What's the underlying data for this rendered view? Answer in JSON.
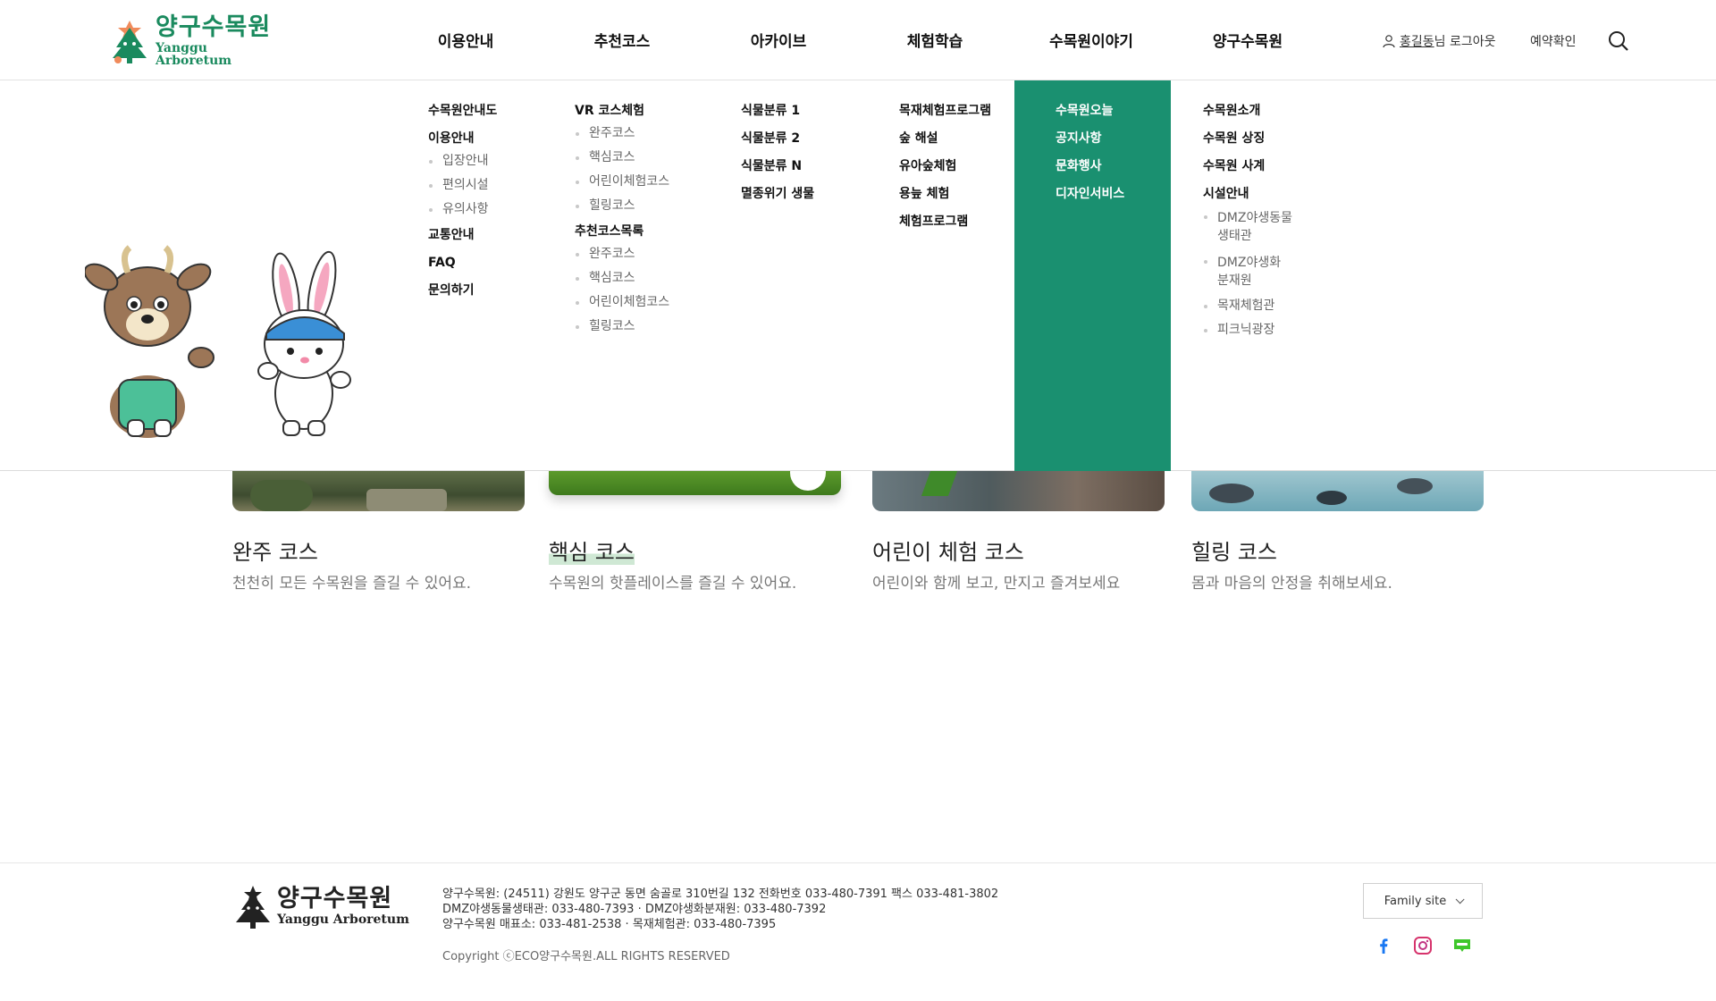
{
  "header": {
    "logo": {
      "ko": "양구수목원",
      "en": "Yanggu Arboretum"
    },
    "nav": [
      "이용안내",
      "추천코스",
      "아카이브",
      "체험학습",
      "수목원이야기",
      "양구수목원"
    ],
    "user": {
      "name": "홍길동",
      "suffix": "님 로그아웃"
    },
    "reserve_label": "예약확인",
    "search_icon": "search-icon"
  },
  "mega_menu": {
    "col1": {
      "items": [
        {
          "label": "수목원안내도"
        },
        {
          "label": "이용안내",
          "sub": [
            "입장안내",
            "편의시설",
            "유의사항"
          ]
        },
        {
          "label": "교통안내"
        },
        {
          "label": "FAQ"
        },
        {
          "label": "문의하기"
        }
      ]
    },
    "col2": {
      "items": [
        {
          "label": "VR 코스체험",
          "sub": [
            "완주코스",
            "핵심코스",
            "어린이체험코스",
            "힐링코스"
          ]
        },
        {
          "label": "추천코스목록",
          "sub": [
            "완주코스",
            "핵심코스",
            "어린이체험코스",
            "힐링코스"
          ]
        }
      ]
    },
    "col3": {
      "items": [
        "식물분류 1",
        "식물분류 2",
        "식물분류 N",
        "멸종위기 생물"
      ]
    },
    "col4": {
      "items": [
        "목재체험프로그램",
        "숲 해설",
        "유아숲체험",
        "용늪 체험",
        "체험프로그램"
      ]
    },
    "col5": {
      "items": [
        "수목원오늘",
        "공지사항",
        "문화행사",
        "디자인서비스"
      ],
      "highlight_color": "#1a9070"
    },
    "col6": {
      "items": [
        {
          "label": "수목원소개"
        },
        {
          "label": "수목원 상징"
        },
        {
          "label": "수목원 사계"
        },
        {
          "label": "시설안내",
          "sub": [
            "DMZ야생동물 생태관",
            "DMZ야생화 분재원",
            "목재체험관",
            "피크닉광장"
          ]
        }
      ]
    }
  },
  "courses": [
    {
      "title": "완주 코스",
      "desc": "천천히 모든 수목원을 즐길 수 있어요."
    },
    {
      "title": "핵심 코스",
      "desc": "수목원의 핫플레이스를 즐길 수 있어요."
    },
    {
      "title": "어린이 체험 코스",
      "desc": "어린이와 함께 보고, 만지고 즐겨보세요"
    },
    {
      "title": "힐링 코스",
      "desc": "몸과 마음의 안정을 취해보세요."
    }
  ],
  "footer": {
    "logo": {
      "ko": "양구수목원",
      "en": "Yanggu Arboretum"
    },
    "info": [
      "양구수목원: (24511) 강원도 양구군 동면 숨골로 310번길 132 전화번호 033-480-7391 팩스 033-481-3802",
      "DMZ야생동물생태관: 033-480-7393 · DMZ야생화분재원: 033-480-7392",
      "양구수목원 매표소: 033-481-2538 · 목재체험관: 033-480-7395"
    ],
    "copyright": "Copyright ⓒECO양구수목원.ALL RIGHTS RESERVED",
    "family_site": "Family site",
    "sns": [
      "facebook-icon",
      "instagram-icon",
      "blog-icon"
    ]
  },
  "colors": {
    "brand_green": "#1a8a5e",
    "panel_green": "#1a9070"
  }
}
